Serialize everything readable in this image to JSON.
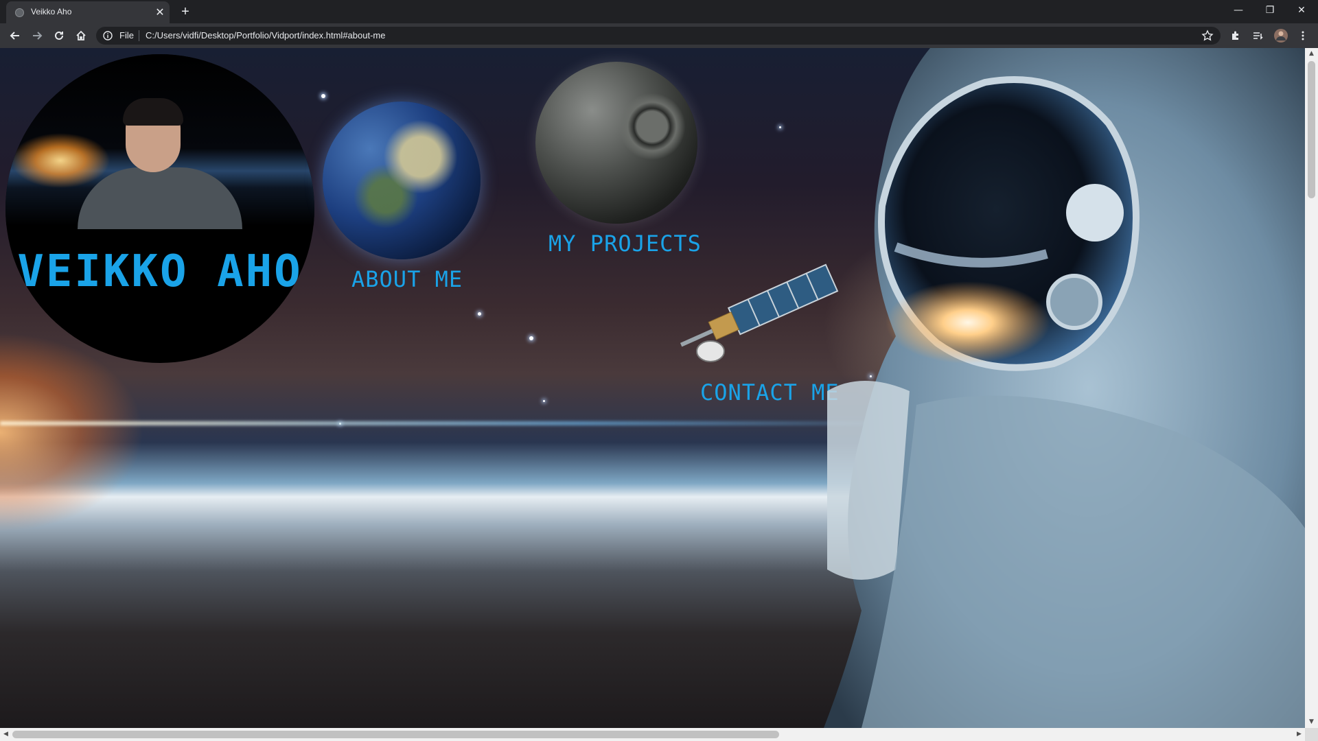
{
  "browser": {
    "tab_title": "Veikko Aho",
    "tab_close": "✕",
    "new_tab": "+",
    "window_minimize": "—",
    "window_restore": "❐",
    "window_close": "✕",
    "url_scheme": "File",
    "url": "C:/Users/vidfi/Desktop/Portfolio/Vidport/index.html#about-me"
  },
  "page": {
    "name": "VEIKKO AHO",
    "nav": {
      "about": "ABOUT ME",
      "projects": "MY PROJECTS",
      "contact": "CONTACT ME"
    }
  },
  "colors": {
    "accent": "#1aa3e8",
    "chrome_dark": "#202124",
    "chrome_toolbar": "#35363a"
  },
  "icons": [
    "back-icon",
    "forward-icon",
    "reload-icon",
    "home-icon",
    "info-icon",
    "bookmark-star-icon",
    "extensions-icon",
    "reading-list-icon",
    "profile-avatar",
    "menu-icon"
  ]
}
